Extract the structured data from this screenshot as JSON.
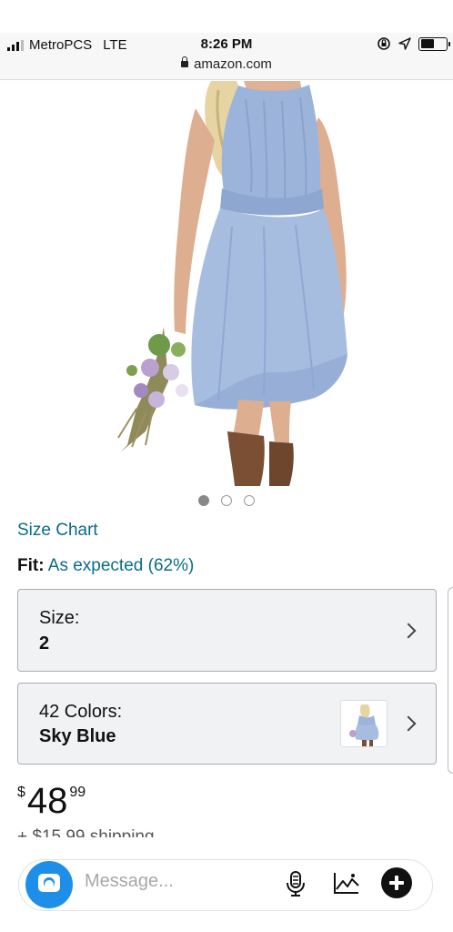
{
  "status_bar": {
    "carrier": "MetroPCS",
    "network": "LTE",
    "time": "8:26 PM",
    "url": "amazon.com",
    "icons": [
      "signal-icon",
      "orientation-lock-icon",
      "location-icon",
      "battery-icon"
    ]
  },
  "product": {
    "image_icon": "dress-photo",
    "image_count": 3,
    "active_image": 1,
    "size_chart_link": "Size Chart",
    "fit_label": "Fit:",
    "fit_value": "As expected (62%)",
    "size_selector": {
      "label": "Size:",
      "value": "2"
    },
    "color_selector": {
      "label": "42 Colors:",
      "value": "Sky Blue"
    },
    "price": {
      "currency": "$",
      "whole": "48",
      "fraction": "99"
    },
    "shipping": "+ $15.99 shipping"
  },
  "message_bar": {
    "placeholder": "Message...",
    "icons": [
      "camera-icon",
      "microphone-icon",
      "gallery-icon",
      "plus-icon"
    ]
  },
  "colors": {
    "link": "#0a6c87",
    "dress": "#9db4da",
    "camera_button": "#1e8fe8"
  }
}
